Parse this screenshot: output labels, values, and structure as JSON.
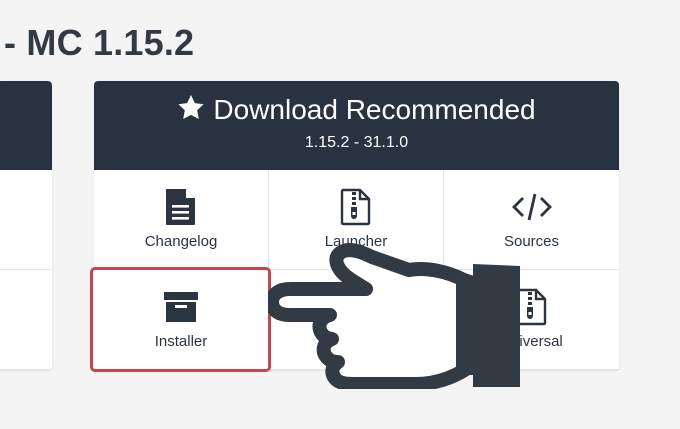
{
  "page": {
    "title": "- MC 1.15.2"
  },
  "download": {
    "title": "Download Recommended",
    "version": "1.15.2 - 31.1.0",
    "star_icon": "star-icon",
    "items": [
      {
        "label": "Changelog",
        "icon": "file-text-icon"
      },
      {
        "label": "Launcher",
        "icon": "zip-file-icon"
      },
      {
        "label": "Sources",
        "icon": "code-icon"
      },
      {
        "label": "Installer",
        "icon": "archive-box-icon"
      },
      {
        "label": "",
        "icon": ""
      },
      {
        "label": "Universal",
        "icon": "zip-file-icon"
      }
    ]
  },
  "overlay": {
    "hand_icon": "pointing-hand-icon",
    "highlight_color": "#c8464b"
  },
  "colors": {
    "panel_header": "#283241",
    "background": "#f4f4f5"
  }
}
